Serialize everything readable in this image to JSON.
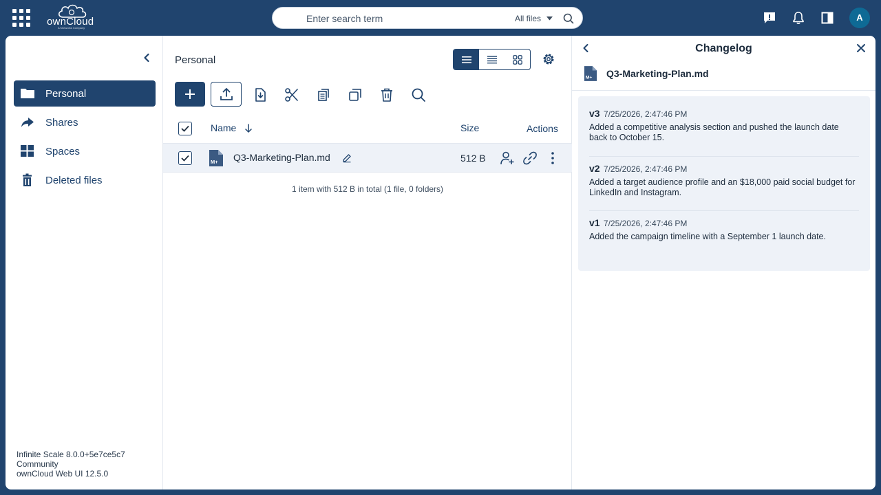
{
  "topbar": {
    "logo_text": "ownCloud",
    "logo_sub": "A Kiteworks Company",
    "search_placeholder": "Enter search term",
    "search_scope": "All files",
    "avatar_initial": "A"
  },
  "sidebar": {
    "items": [
      {
        "label": "Personal",
        "icon": "folder-icon",
        "active": true
      },
      {
        "label": "Shares",
        "icon": "share-icon",
        "active": false
      },
      {
        "label": "Spaces",
        "icon": "spaces-icon",
        "active": false
      },
      {
        "label": "Deleted files",
        "icon": "trash-icon",
        "active": false
      }
    ],
    "version_line1": "Infinite Scale 8.0.0+5e7ce5c7",
    "version_line2": "Community",
    "version_line3": "ownCloud Web UI 12.5.0"
  },
  "files": {
    "breadcrumb": "Personal",
    "columns": {
      "name": "Name",
      "size": "Size",
      "actions": "Actions"
    },
    "rows": [
      {
        "name": "Q3-Marketing-Plan.md",
        "size": "512 B",
        "selected": true
      }
    ],
    "summary": "1 item with 512 B in total (1 file, 0 folders)"
  },
  "panel": {
    "title": "Changelog",
    "file_name": "Q3-Marketing-Plan.md",
    "entries": [
      {
        "version": "v3",
        "timestamp": "7/25/2026, 2:47:46 PM",
        "text": "Added a competitive analysis section and pushed the launch date back to October 15."
      },
      {
        "version": "v2",
        "timestamp": "7/25/2026, 2:47:46 PM",
        "text": "Added a target audience profile and an $18,000 paid social budget for LinkedIn and Instagram."
      },
      {
        "version": "v1",
        "timestamp": "7/25/2026, 2:47:46 PM",
        "text": "Added the campaign timeline with a September 1 launch date."
      }
    ]
  },
  "colors": {
    "brand": "#20446e",
    "selection": "#eef2f8",
    "avatar": "#0e6a95"
  }
}
